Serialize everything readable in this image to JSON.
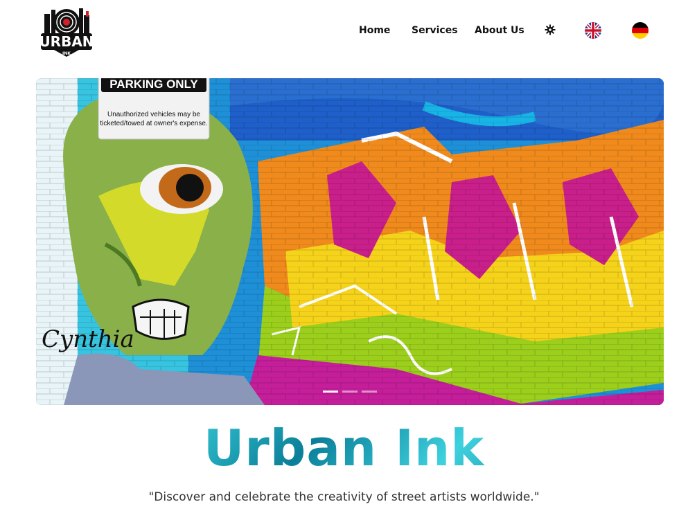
{
  "header": {
    "logo": {
      "main": "URBAN",
      "sub": "INK"
    },
    "nav": {
      "home": "Home",
      "services": "Services",
      "about": "About Us"
    },
    "theme_icon": "gear-icon",
    "languages": [
      {
        "code": "en",
        "icon": "uk-flag-icon"
      },
      {
        "code": "de",
        "icon": "german-flag-icon"
      }
    ]
  },
  "hero": {
    "sign_title": "PARKING ONLY",
    "sign_text_1": "Unauthorized vehicles may be",
    "sign_text_2": "ticketed/towed at owner's expense.",
    "slides": 3,
    "active_slide": 1
  },
  "title": "Urban Ink",
  "tagline": "\"Discover and celebrate the creativity of street artists worldwide.\"",
  "colors": {
    "title_teal": "#1aa3b8",
    "text_dark": "#111111"
  }
}
